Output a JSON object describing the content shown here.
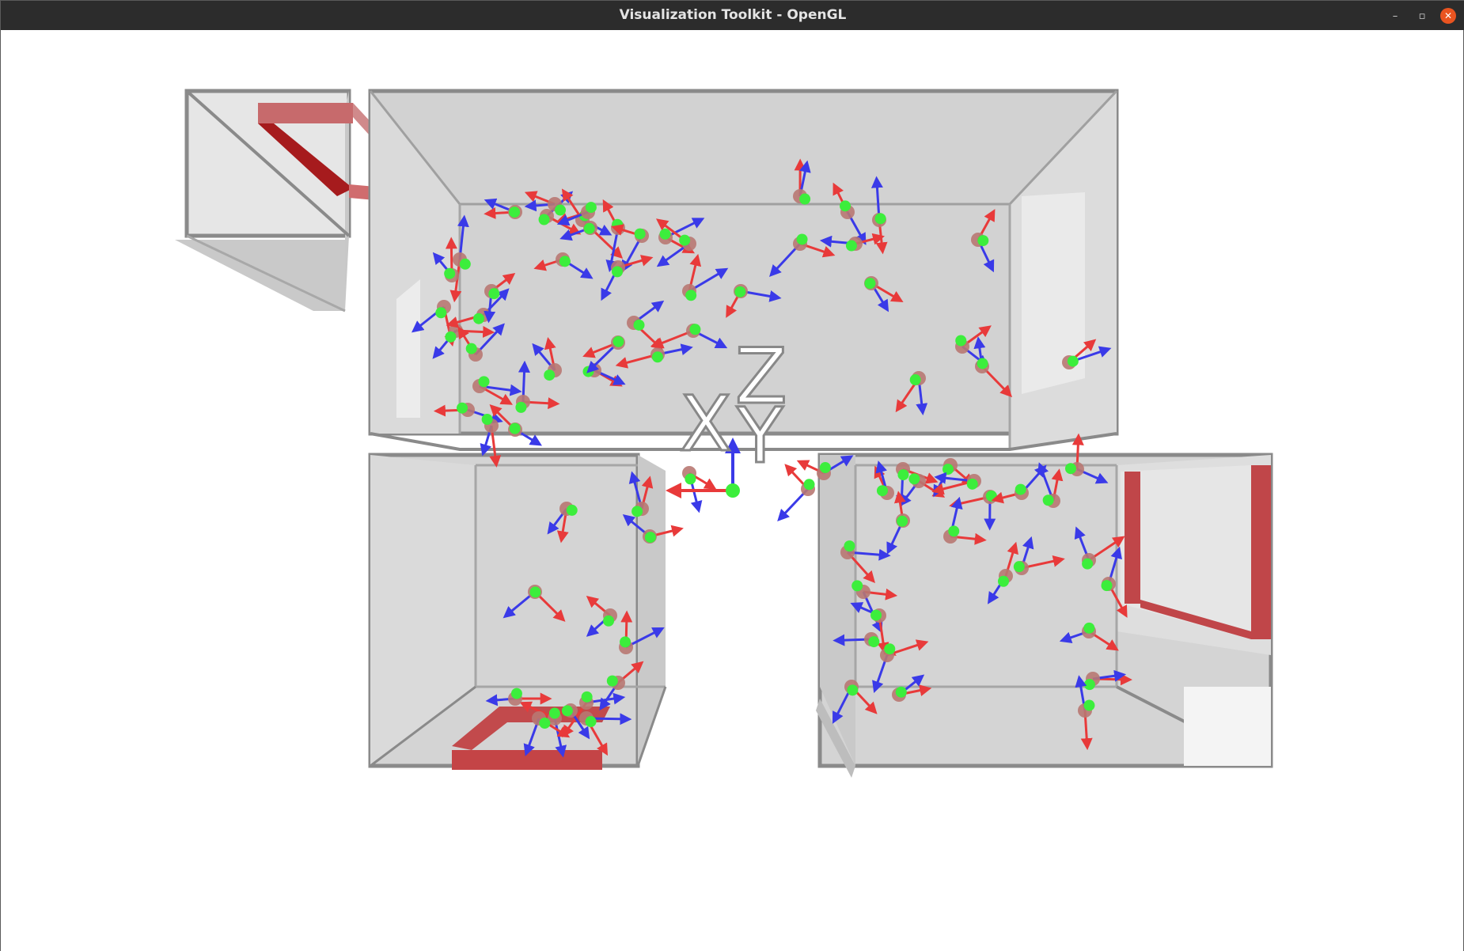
{
  "window": {
    "title": "Visualization Toolkit - OpenGL",
    "controls": {
      "minimize": "–",
      "maximize": "▫",
      "close": "✕"
    }
  },
  "scene": {
    "axes_labels": {
      "x": "X",
      "y": "Y",
      "z": "Z"
    },
    "colors": {
      "background": "#ffffff",
      "wall": "#d0d0d0",
      "wall_edge": "#8a8a8a",
      "door": "#c0484a",
      "x_axis": "#e83a3a",
      "y_axis": "#3cee3c",
      "z_axis": "#3a3ae8",
      "sphere": "#b87872"
    }
  }
}
